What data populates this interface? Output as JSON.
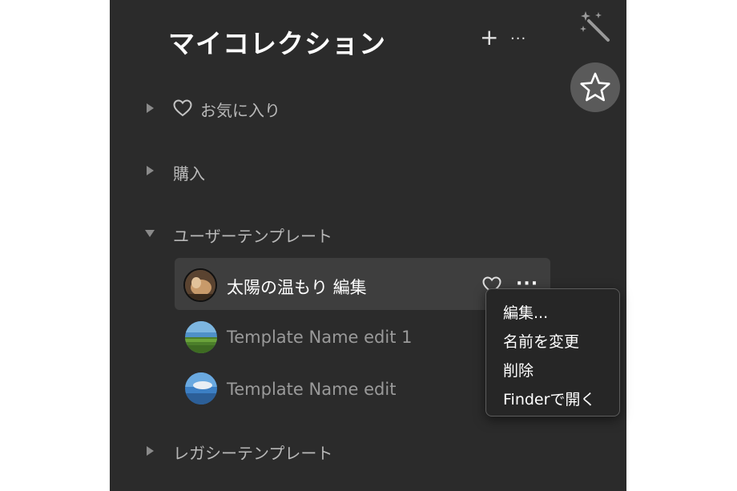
{
  "header": {
    "title": "マイコレクション",
    "add_label": "+",
    "more_label": "···"
  },
  "icons": {
    "wand": "magic-wand-icon",
    "star": "star-icon",
    "heart": "heart-icon",
    "more": "more-horizontal-icon",
    "disclosure": "disclosure-triangle-icon"
  },
  "sections": {
    "favorites": {
      "label": "お気に入り",
      "expanded": false
    },
    "purchased": {
      "label": "購入",
      "expanded": false
    },
    "user_templates": {
      "label": "ユーザーテンプレート",
      "expanded": true,
      "items": [
        {
          "label": "太陽の温もり 編集",
          "selected": true,
          "more_label": "···"
        },
        {
          "label": "Template Name edit 1",
          "selected": false
        },
        {
          "label": "Template Name edit",
          "selected": false
        }
      ]
    },
    "legacy_templates": {
      "label": "レガシーテンプレート",
      "expanded": false
    }
  },
  "context_menu": {
    "items": [
      {
        "label": "編集..."
      },
      {
        "label": "名前を変更"
      },
      {
        "label": "削除"
      },
      {
        "label": "Finderで開く"
      }
    ]
  },
  "colors": {
    "panel_bg": "#2b2b2b",
    "selected_row_bg": "#3e3e3e",
    "menu_bg": "#262626",
    "star_button_bg": "#5a5a5a"
  }
}
